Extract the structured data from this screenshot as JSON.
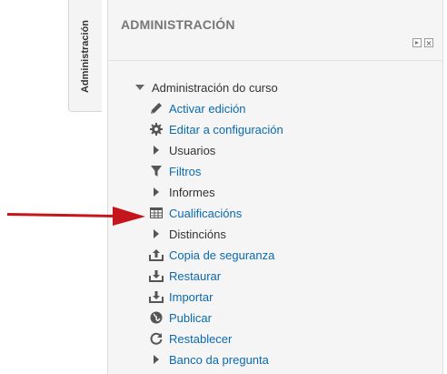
{
  "dock": {
    "label": "Administración"
  },
  "block": {
    "title": "ADMINISTRACIÓN"
  },
  "tree": {
    "root_label": "Administración do curso",
    "items": [
      {
        "label": "Activar edición",
        "icon": "pencil-icon",
        "link": true
      },
      {
        "label": "Editar a configuración",
        "icon": "gear-icon",
        "link": true
      },
      {
        "label": "Usuarios",
        "icon": "expand-arrow-icon",
        "link": false
      },
      {
        "label": "Filtros",
        "icon": "filter-icon",
        "link": true
      },
      {
        "label": "Informes",
        "icon": "expand-arrow-icon",
        "link": false
      },
      {
        "label": "Cualificacións",
        "icon": "grades-table-icon",
        "link": true
      },
      {
        "label": "Distincións",
        "icon": "expand-arrow-icon",
        "link": false
      },
      {
        "label": "Copia de seguranza",
        "icon": "backup-icon",
        "link": true
      },
      {
        "label": "Restaurar",
        "icon": "restore-icon",
        "link": true
      },
      {
        "label": "Importar",
        "icon": "import-icon",
        "link": true
      },
      {
        "label": "Publicar",
        "icon": "publish-globe-icon",
        "link": true
      },
      {
        "label": "Restablecer",
        "icon": "reset-icon",
        "link": true
      },
      {
        "label": "Banco da pregunta",
        "icon": "expand-arrow-icon",
        "link": true
      }
    ]
  },
  "colors": {
    "link": "#0a6ab0",
    "arrow": "#c4161c",
    "panel_bg": "#f5f5f5",
    "title": "#777777"
  }
}
